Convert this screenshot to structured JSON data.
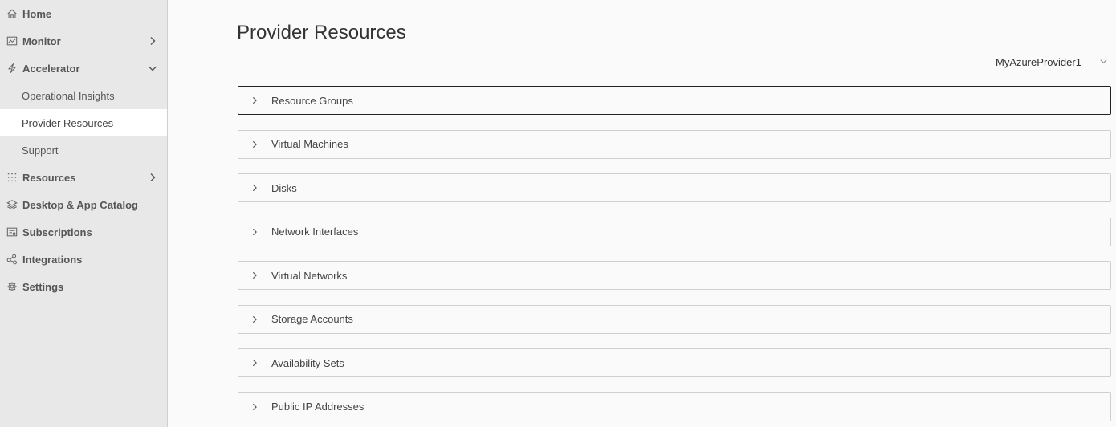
{
  "sidebar": {
    "items": [
      {
        "label": "Home",
        "icon": "home-icon"
      },
      {
        "label": "Monitor",
        "icon": "monitor-icon"
      },
      {
        "label": "Accelerator",
        "icon": "lightning-icon"
      },
      {
        "label": "Resources",
        "icon": "grid-icon"
      },
      {
        "label": "Desktop & App Catalog",
        "icon": "layers-icon"
      },
      {
        "label": "Subscriptions",
        "icon": "subscriptions-icon"
      },
      {
        "label": "Integrations",
        "icon": "integrations-icon"
      },
      {
        "label": "Settings",
        "icon": "gear-icon"
      }
    ],
    "accelerator_children": [
      {
        "label": "Operational Insights"
      },
      {
        "label": "Provider Resources",
        "active": true
      },
      {
        "label": "Support"
      }
    ]
  },
  "main": {
    "title": "Provider Resources",
    "provider_select": {
      "value": "MyAzureProvider1"
    },
    "panels": [
      {
        "label": "Resource Groups"
      },
      {
        "label": "Virtual Machines"
      },
      {
        "label": "Disks"
      },
      {
        "label": "Network Interfaces"
      },
      {
        "label": "Virtual Networks"
      },
      {
        "label": "Storage Accounts"
      },
      {
        "label": "Availability Sets"
      },
      {
        "label": "Public IP Addresses"
      }
    ]
  },
  "colors": {
    "sidebar_bg": "#e8e8e8",
    "active_bg": "#ffffff",
    "page_bg": "#fafafa",
    "text": "#565656",
    "panel_border": "#cfcfcf",
    "focus_border": "#222222"
  }
}
